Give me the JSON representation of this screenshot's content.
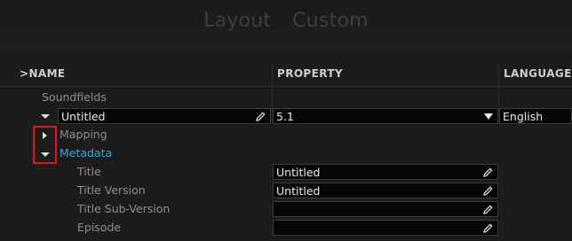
{
  "header": {
    "tabs": [
      {
        "label": "Layout"
      },
      {
        "label": "Custom"
      }
    ]
  },
  "columns": {
    "name": ">NAME",
    "property": "PROPERTY",
    "language": "LANGUAGE"
  },
  "tree": {
    "soundfields_label": "Soundfields",
    "soundfield_name_value": "Untitled",
    "soundfield_format_value": "5.1",
    "soundfield_language_value": "English",
    "mapping_label": "Mapping",
    "metadata_label": "Metadata",
    "metadata_fields": [
      {
        "label": "Title",
        "value": "Untitled"
      },
      {
        "label": "Title Version",
        "value": "Untitled"
      },
      {
        "label": "Title Sub-Version",
        "value": ""
      },
      {
        "label": "Episode",
        "value": ""
      }
    ]
  },
  "colors": {
    "accent": "#2fa8e4",
    "highlight_box": "#e0141e",
    "background": "#1c1c1c"
  }
}
